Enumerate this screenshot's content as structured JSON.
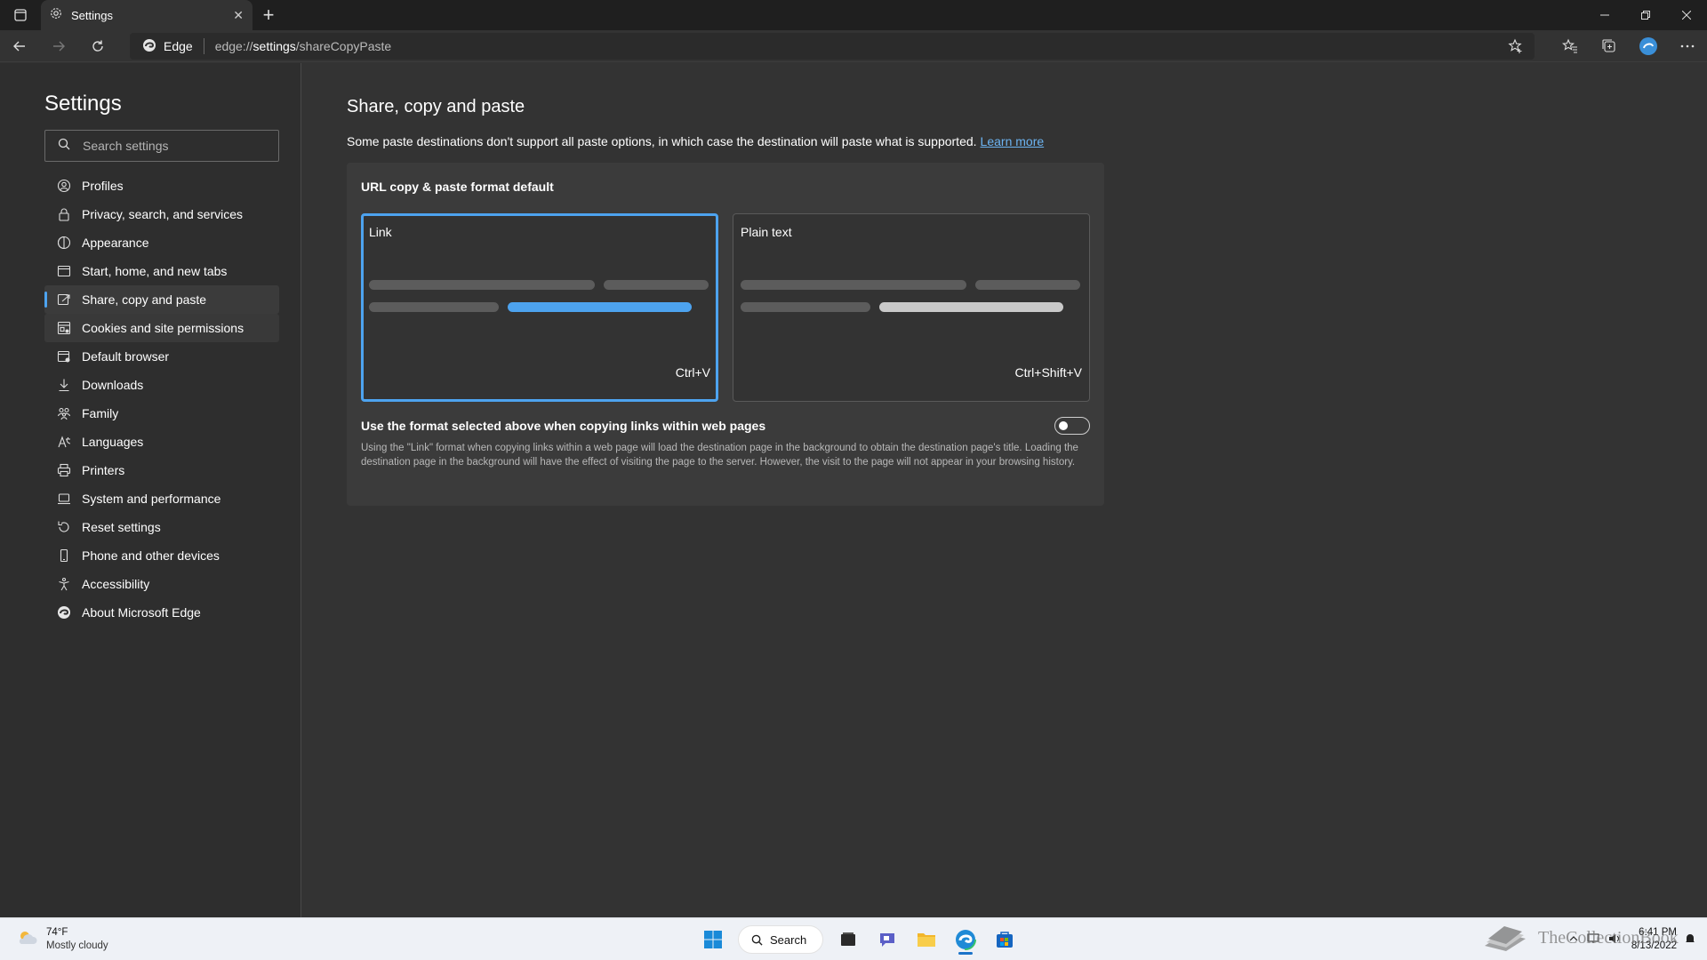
{
  "browser": {
    "tab_title": "Settings",
    "edge_label": "Edge",
    "url_host": "edge://",
    "url_path": "settings",
    "url_rest": "/shareCopyPaste"
  },
  "sidebar": {
    "title": "Settings",
    "search_placeholder": "Search settings",
    "items": [
      {
        "label": "Profiles",
        "icon": "profile-icon"
      },
      {
        "label": "Privacy, search, and services",
        "icon": "lock-icon"
      },
      {
        "label": "Appearance",
        "icon": "appearance-icon"
      },
      {
        "label": "Start, home, and new tabs",
        "icon": "home-tabs-icon"
      },
      {
        "label": "Share, copy and paste",
        "icon": "share-icon"
      },
      {
        "label": "Cookies and site permissions",
        "icon": "cookies-icon"
      },
      {
        "label": "Default browser",
        "icon": "browser-icon"
      },
      {
        "label": "Downloads",
        "icon": "download-icon"
      },
      {
        "label": "Family",
        "icon": "family-icon"
      },
      {
        "label": "Languages",
        "icon": "languages-icon"
      },
      {
        "label": "Printers",
        "icon": "printer-icon"
      },
      {
        "label": "System and performance",
        "icon": "laptop-icon"
      },
      {
        "label": "Reset settings",
        "icon": "reset-icon"
      },
      {
        "label": "Phone and other devices",
        "icon": "phone-icon"
      },
      {
        "label": "Accessibility",
        "icon": "accessibility-icon"
      },
      {
        "label": "About Microsoft Edge",
        "icon": "edge-logo-icon"
      }
    ],
    "active_index": 4
  },
  "main": {
    "title": "Share, copy and paste",
    "description": "Some paste destinations don't support all paste options, in which case the destination will paste what is supported.",
    "learn_more": "Learn more",
    "card_title": "URL copy & paste format default",
    "options": [
      {
        "label": "Link",
        "shortcut": "Ctrl+V",
        "selected": true
      },
      {
        "label": "Plain text",
        "shortcut": "Ctrl+Shift+V",
        "selected": false
      }
    ],
    "toggle_label": "Use the format selected above when copying links within web pages",
    "toggle_on": false,
    "toggle_description": "Using the \"Link\" format when copying links within a web page will load the destination page in the background to obtain the destination page's title. Loading the destination page in the background will have the effect of visiting the page to the server. However, the visit to the page will not appear in your browsing history."
  },
  "taskbar": {
    "temperature": "74°F",
    "condition": "Mostly cloudy",
    "search_label": "Search",
    "time": "6:41 PM",
    "date": "8/13/2022"
  },
  "watermark": {
    "text": "TheCollectionBook"
  },
  "colors": {
    "accent": "#4da3ef",
    "background": "#333333",
    "sidebar": "#2e2e2e",
    "card": "#3b3b3b"
  }
}
